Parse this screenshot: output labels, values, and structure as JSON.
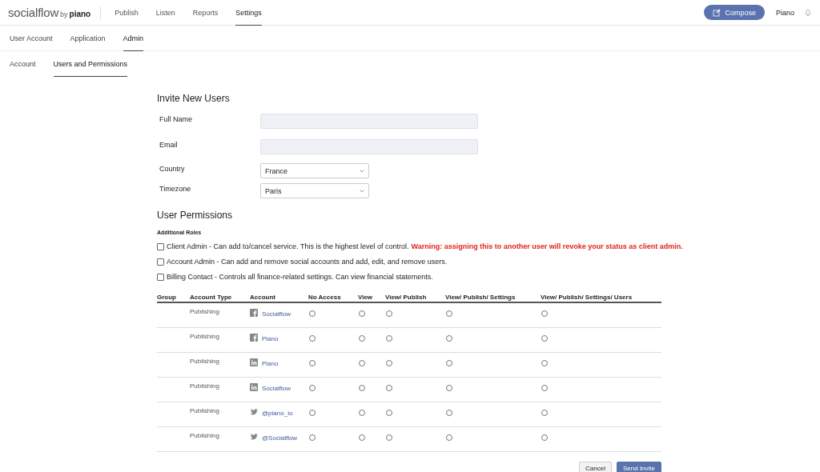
{
  "brand": {
    "name": "socialflow",
    "by": "by",
    "partner": "piano"
  },
  "main_nav": [
    {
      "label": "Publish",
      "selected": false
    },
    {
      "label": "Listen",
      "selected": false
    },
    {
      "label": "Reports",
      "selected": false
    },
    {
      "label": "Settings",
      "selected": true
    }
  ],
  "compose_button": "Compose",
  "user_menu": "Piano",
  "settings_tabs": [
    {
      "label": "User Account",
      "selected": false
    },
    {
      "label": "Application",
      "selected": false
    },
    {
      "label": "Admin",
      "selected": true
    }
  ],
  "admin_tabs": [
    {
      "label": "Account",
      "selected": false
    },
    {
      "label": "Users and Permissions",
      "selected": true
    }
  ],
  "invite": {
    "title": "Invite New Users",
    "fields": [
      {
        "label": "Full Name",
        "kind": "text"
      },
      {
        "label": "Email",
        "kind": "text"
      },
      {
        "label": "Country",
        "kind": "select",
        "value": "France"
      },
      {
        "label": "Timezone",
        "kind": "select",
        "value": "Paris"
      }
    ]
  },
  "permissions": {
    "title": "User Permissions",
    "roles_title": "Additional Roles",
    "roles": [
      {
        "text": "Client Admin - Can add to/cancel service. This is the highest level of control.",
        "warning": "Warning: assigning this to another user will revoke your status as client admin.",
        "checked": false
      },
      {
        "text": "Account Admin - Can add and remove social accounts and add, edit, and remove users.",
        "checked": false
      },
      {
        "text": "Billing Contact - Controls all finance-related settings. Can view financial statements.",
        "checked": false
      }
    ]
  },
  "table": {
    "columns": [
      "Group",
      "Account Type",
      "Account",
      "No Access",
      "View",
      "View/ Publish",
      "View/ Publish/ Settings",
      "View/ Publish/ Settings/ Users"
    ],
    "rows": [
      {
        "account_type": "Publishing",
        "kind": "facebook",
        "account": "Socialflow",
        "access": [
          false,
          false,
          false,
          false,
          false
        ]
      },
      {
        "account_type": "Publishing",
        "kind": "facebook",
        "account": "Piano",
        "access": [
          false,
          false,
          false,
          false,
          false
        ]
      },
      {
        "account_type": "Publishing",
        "kind": "linkedin",
        "account": "Piano",
        "access": [
          false,
          false,
          false,
          false,
          false
        ]
      },
      {
        "account_type": "Publishing",
        "kind": "linkedin",
        "account": "Socialflow",
        "access": [
          false,
          false,
          false,
          false,
          false
        ]
      },
      {
        "account_type": "Publishing",
        "kind": "twitter",
        "account": "@piano_io",
        "access": [
          false,
          false,
          false,
          false,
          false
        ]
      },
      {
        "account_type": "Publishing",
        "kind": "twitter",
        "account": "@Socialflow",
        "access": [
          false,
          false,
          false,
          false,
          false
        ]
      }
    ]
  },
  "buttons": {
    "cancel": "Cancel",
    "submit": "Send Invite"
  }
}
